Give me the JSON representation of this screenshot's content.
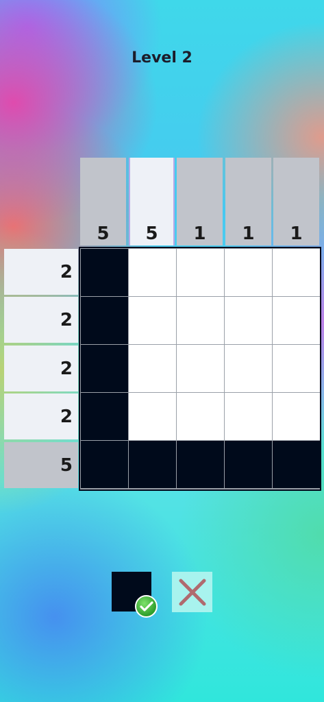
{
  "header": {
    "level_title": "Level 2"
  },
  "puzzle": {
    "column_clues": [
      "5",
      "5",
      "1",
      "1",
      "1"
    ],
    "row_clues": [
      "2",
      "2",
      "2",
      "2",
      "5"
    ],
    "highlighted_column": 1,
    "grid": [
      [
        1,
        0,
        0,
        0,
        0
      ],
      [
        1,
        0,
        0,
        0,
        0
      ],
      [
        1,
        0,
        0,
        0,
        0
      ],
      [
        1,
        0,
        0,
        0,
        0
      ],
      [
        1,
        1,
        1,
        1,
        1
      ]
    ]
  },
  "tools": {
    "selected": "fill",
    "items": [
      {
        "name": "fill",
        "icon": "filled-square-icon"
      },
      {
        "name": "cross",
        "icon": "cross-icon"
      }
    ]
  },
  "colors": {
    "filled_cell": "#000a1b",
    "empty_cell": "#ffffff",
    "cross_mark": "#b06a6e",
    "check_badge": "#3faa35"
  }
}
